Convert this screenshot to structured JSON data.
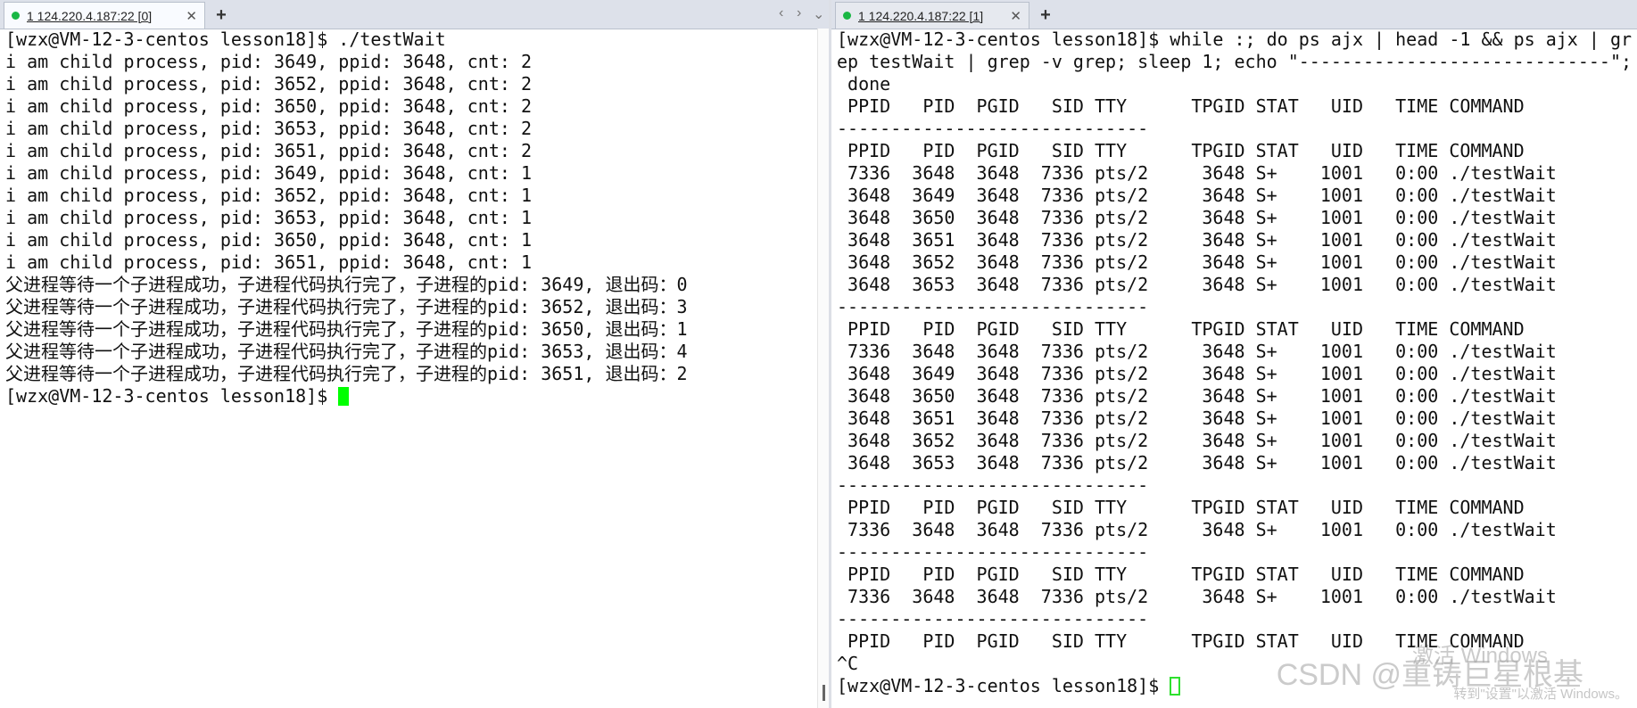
{
  "left_tab": {
    "label": "1 124.220.4.187:22 [0]",
    "close": "✕",
    "status_color": "#1ab744"
  },
  "right_tab": {
    "label": "1 124.220.4.187:22 [1]",
    "close": "✕",
    "status_color": "#1ab744"
  },
  "new_tab_symbol": "+",
  "tab_nav": {
    "prev": "‹",
    "next": "›",
    "menu": "⌄"
  },
  "left_terminal": {
    "lines": [
      "[wzx@VM-12-3-centos lesson18]$ ./testWait",
      "i am child process, pid: 3649, ppid: 3648, cnt: 2",
      "i am child process, pid: 3652, ppid: 3648, cnt: 2",
      "i am child process, pid: 3650, ppid: 3648, cnt: 2",
      "i am child process, pid: 3653, ppid: 3648, cnt: 2",
      "i am child process, pid: 3651, ppid: 3648, cnt: 2",
      "i am child process, pid: 3649, ppid: 3648, cnt: 1",
      "i am child process, pid: 3652, ppid: 3648, cnt: 1",
      "i am child process, pid: 3653, ppid: 3648, cnt: 1",
      "i am child process, pid: 3650, ppid: 3648, cnt: 1",
      "i am child process, pid: 3651, ppid: 3648, cnt: 1",
      "父进程等待一个子进程成功，子进程代码执行完了，子进程的pid: 3649, 退出码：0",
      "父进程等待一个子进程成功，子进程代码执行完了，子进程的pid: 3652, 退出码：3",
      "父进程等待一个子进程成功，子进程代码执行完了，子进程的pid: 3650, 退出码：1",
      "父进程等待一个子进程成功，子进程代码执行完了，子进程的pid: 3653, 退出码：4",
      "父进程等待一个子进程成功，子进程代码执行完了，子进程的pid: 3651, 退出码：2"
    ],
    "prompt": "[wzx@VM-12-3-centos lesson18]$ ",
    "cursor_color": "#00ff00"
  },
  "right_terminal": {
    "lines": [
      "[wzx@VM-12-3-centos lesson18]$ while :; do ps ajx | head -1 && ps ajx | gr",
      "ep testWait | grep -v grep; sleep 1; echo \"-----------------------------\";",
      " done",
      " PPID   PID  PGID   SID TTY      TPGID STAT   UID   TIME COMMAND",
      "-----------------------------",
      " PPID   PID  PGID   SID TTY      TPGID STAT   UID   TIME COMMAND",
      " 7336  3648  3648  7336 pts/2     3648 S+    1001   0:00 ./testWait",
      " 3648  3649  3648  7336 pts/2     3648 S+    1001   0:00 ./testWait",
      " 3648  3650  3648  7336 pts/2     3648 S+    1001   0:00 ./testWait",
      " 3648  3651  3648  7336 pts/2     3648 S+    1001   0:00 ./testWait",
      " 3648  3652  3648  7336 pts/2     3648 S+    1001   0:00 ./testWait",
      " 3648  3653  3648  7336 pts/2     3648 S+    1001   0:00 ./testWait",
      "-----------------------------",
      " PPID   PID  PGID   SID TTY      TPGID STAT   UID   TIME COMMAND",
      " 7336  3648  3648  7336 pts/2     3648 S+    1001   0:00 ./testWait",
      " 3648  3649  3648  7336 pts/2     3648 S+    1001   0:00 ./testWait",
      " 3648  3650  3648  7336 pts/2     3648 S+    1001   0:00 ./testWait",
      " 3648  3651  3648  7336 pts/2     3648 S+    1001   0:00 ./testWait",
      " 3648  3652  3648  7336 pts/2     3648 S+    1001   0:00 ./testWait",
      " 3648  3653  3648  7336 pts/2     3648 S+    1001   0:00 ./testWait",
      "-----------------------------",
      " PPID   PID  PGID   SID TTY      TPGID STAT   UID   TIME COMMAND",
      " 7336  3648  3648  7336 pts/2     3648 S+    1001   0:00 ./testWait",
      "-----------------------------",
      " PPID   PID  PGID   SID TTY      TPGID STAT   UID   TIME COMMAND",
      " 7336  3648  3648  7336 pts/2     3648 S+    1001   0:00 ./testWait",
      "-----------------------------",
      " PPID   PID  PGID   SID TTY      TPGID STAT   UID   TIME COMMAND",
      "^C"
    ],
    "prompt": "[wzx@VM-12-3-centos lesson18]$ ",
    "cursor_color": "#2ee02e"
  },
  "watermark": {
    "activate": "激活 Windows",
    "credit": "CSDN @重铸巨星根基",
    "hint": "转到\"设置\"以激活 Windows。"
  }
}
